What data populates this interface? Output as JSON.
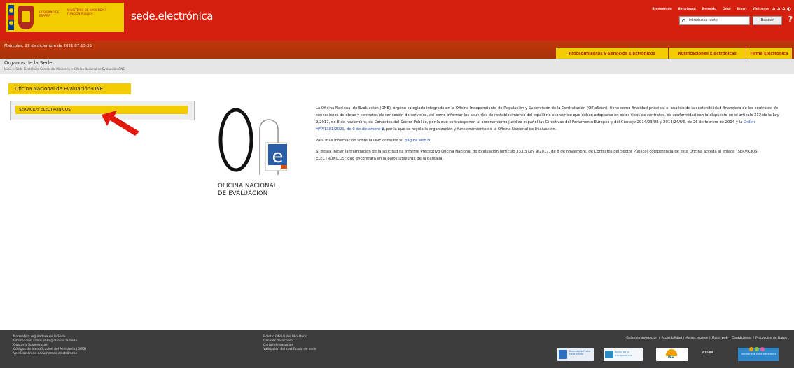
{
  "header": {
    "gov_label": "GOBIERNO DE ESPAÑA",
    "ministry_label": "MINISTERIO DE HACIENDA Y FUNCIÓN PÚBLICA",
    "sede_title": "sede.electrónica",
    "top_links": [
      "Bienvenido",
      "Benvingut",
      "Benvido",
      "Ongi Etorri",
      "Welcome"
    ],
    "font_size_controls": "A A A",
    "contrast_icon": "contrast-icon",
    "search": {
      "placeholder": "introduzca texto",
      "button_label": "Buscar",
      "icon": "search-icon"
    },
    "help_label": "?"
  },
  "datebar": {
    "date": "Miércoles, 29 de diciembre de 2021 07:13:35",
    "tabs": [
      "Procedimientos y Servicios Electrónicos",
      "Notificaciones Electrónicas",
      "Firma Electrónica"
    ]
  },
  "breadcrumb": {
    "title": "Órganos de la Sede",
    "path": "Inicio > Sede Electrónica Central del Ministerio > Oficina Nacional de Evaluación-ONE"
  },
  "sidebar": {
    "office_title": "Oficina Nacional de Evaluación-ONE",
    "services_link": "SERVICIOS ELECTRÓNICOS"
  },
  "logo": {
    "line1": "OFICINA NACIONAL",
    "line2": "DE EVALUACION"
  },
  "content": {
    "p1_a": "La Oficina Nacional de Evaluación (ONE), órgano colegiado integrado en la Oficina Independiente de Regulación y Supervisión de la Contratación (OIReScon), tiene como finalidad principal el análisis de la sostenibilidad financiera de los contratos de concesiones de obras y contratos de concesión de servicios, así como informar los acuerdos de restablecimiento del equilibrio económico que deban adoptarse en estos tipos de contratos, de conformidad con lo dispuesto en el artículo 333 de la Ley 9/2017, de 8 de noviembre, de Contratos del Sector Público, por la que se transponen al ordenamiento jurídico español las Directivas del Parlamento Europeo y del Consejo 2014/23/UE y 2014/24/UE, de 26 de febrero de 2014 y la ",
    "p1_link": "Orden HFP/1381/2021, de 9 de diciembre",
    "p1_b": ", por la que se regula la organización y funcionamiento de la Oficina Nacional de Evaluación.",
    "p2_a": "Para más información sobre la ONE consulte su ",
    "p2_link": "página web",
    "p2_b": ".",
    "p3": "Si desea iniciar la tramitación de la solicitud de Informe Preceptivo Oficina Nacional de Evaluación (artículo 333.3 Ley 9/2017, de 8 de noviembre, de Contratos del Sector Público) competencia de esta Oficina acceda al enlace \"SERVICIOS ELECTRÓNICOS\" que encontrará en la parte izquierda de la pantalla."
  },
  "footer": {
    "col1": [
      "Normativa reguladora de la Sede",
      "Información sobre el Registro de la Sede",
      "Quejas y Sugerencias",
      "Códigos de Identificación del Ministerio (DIR3)",
      "Verificación de documentos electrónicos"
    ],
    "col2": [
      "Boletín Oficial del Ministerio",
      "Canales de acceso",
      "Cartas de servicios",
      "Validación del certificado de sede"
    ],
    "links": [
      "Guía de navegación",
      "Accesibilidad",
      "Avisos legales",
      "Mapa web",
      "Contáctenos",
      "Protección de Datos"
    ],
    "badges": [
      "Calendario Fecha Hora oficial",
      "portal de la transparencia",
      "PAe",
      "WAI-AA",
      "Acceso a la sede electrónica"
    ]
  },
  "colors": {
    "header_red": "#d5200f",
    "accent_yellow": "#f2cb00",
    "footer_gray": "#3d3d3d",
    "link_blue": "#1b4ea8"
  }
}
